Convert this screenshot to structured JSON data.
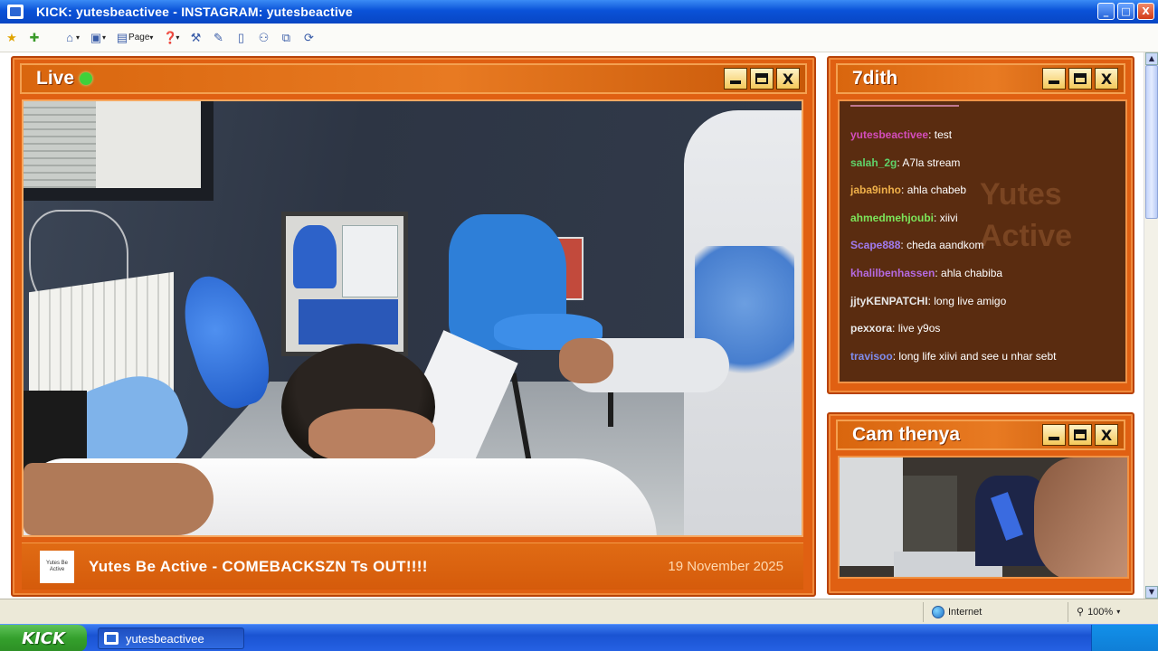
{
  "window": {
    "title": "KICK: yutesbeactivee - INSTAGRAM: yutesbeactive",
    "minimize_icon": "_",
    "maximize_icon": "□",
    "close_icon": "X"
  },
  "toolbar": {
    "page_label": "Page"
  },
  "live_panel": {
    "title": "Live",
    "status_color": "#3fd13a",
    "caption": "Yutes Be Active - COMEBACKSZN Ts OUT!!!!",
    "date": "19 November 2025",
    "logo_text": "Yutes Be Active"
  },
  "chat_panel": {
    "title": "7dith",
    "watermark": "Yutes Active",
    "messages": [
      {
        "user": "yutesbeactivee",
        "text": "test",
        "color": "#d44dbb"
      },
      {
        "user": "salah_2g",
        "text": "A7la stream",
        "color": "#5fd26a"
      },
      {
        "user": "jaba9inho",
        "text": "ahla chabeb",
        "color": "#f0b14a"
      },
      {
        "user": "ahmedmehjoubi",
        "text": "xiivi",
        "color": "#7ce55a"
      },
      {
        "user": "Scape888",
        "text": "cheda aandkom",
        "color": "#a07bf0"
      },
      {
        "user": "khalilbenhassen",
        "text": "ahla chabiba",
        "color": "#b46ae0"
      },
      {
        "user": "jjtyKENPATCHI",
        "text": "long live amigo",
        "color": "#e8e8e8"
      },
      {
        "user": "pexxora",
        "text": "live y9os",
        "color": "#e8e8e8"
      },
      {
        "user": "travisoo",
        "text": "long life xiivi and see u nhar sebt",
        "color": "#7f8dee"
      }
    ]
  },
  "cam_panel": {
    "title": "Cam thenya"
  },
  "status_bar": {
    "zone": "Internet",
    "zoom": "100%"
  },
  "taskbar": {
    "start_label": "KICK",
    "task_item": "yutesbeactivee"
  }
}
